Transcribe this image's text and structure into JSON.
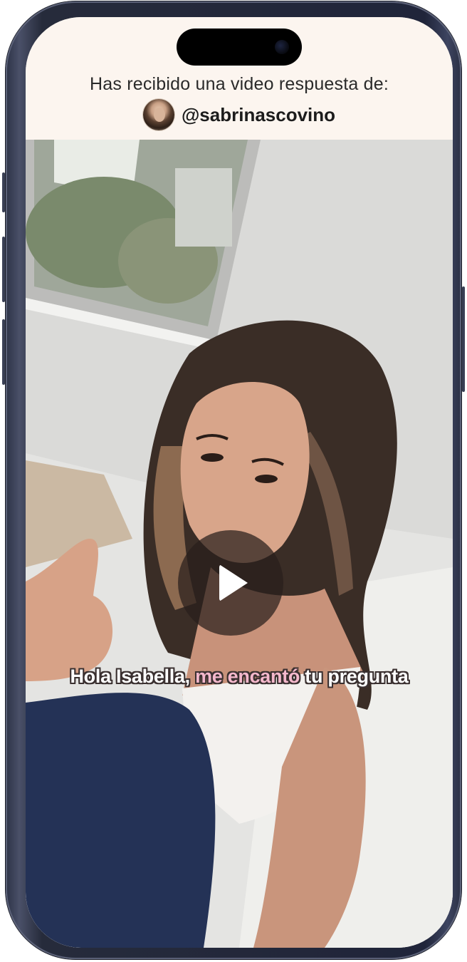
{
  "header": {
    "title": "Has recibido una video respuesta de:",
    "username": "@sabrinascovino"
  },
  "video": {
    "caption_part1": "Hola Isabella, ",
    "caption_highlight": "me encantó",
    "caption_part2": " tu pregunta",
    "play_icon": "play-icon"
  },
  "colors": {
    "header_bg": "#fcf5ef",
    "caption_highlight": "#f4b8cc",
    "frame": "#20253a"
  }
}
